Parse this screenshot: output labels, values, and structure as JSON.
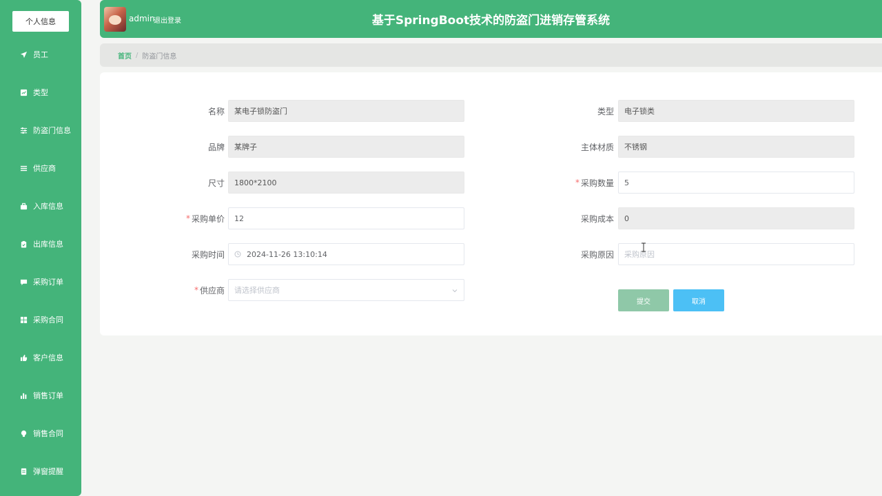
{
  "sidebar": {
    "profile_label": "个人信息",
    "items": [
      {
        "label": "员工",
        "icon": "paper-plane-icon"
      },
      {
        "label": "类型",
        "icon": "chart-icon"
      },
      {
        "label": "防盗门信息",
        "icon": "sliders-icon"
      },
      {
        "label": "供应商",
        "icon": "list-icon"
      },
      {
        "label": "入库信息",
        "icon": "briefcase-icon"
      },
      {
        "label": "出库信息",
        "icon": "clipboard-icon"
      },
      {
        "label": "采购订单",
        "icon": "comment-icon"
      },
      {
        "label": "采购合同",
        "icon": "grid-icon"
      },
      {
        "label": "客户信息",
        "icon": "thumbs-up-icon"
      },
      {
        "label": "销售订单",
        "icon": "bar-chart-icon"
      },
      {
        "label": "销售合同",
        "icon": "bulb-icon"
      },
      {
        "label": "弹窗提醒",
        "icon": "document-icon"
      }
    ]
  },
  "header": {
    "username": "admin",
    "logout": "退出登录",
    "title": "基于SpringBoot技术的防盗门进销存管系统"
  },
  "breadcrumb": {
    "home": "首页",
    "separator": "/",
    "current": "防盗门信息"
  },
  "form": {
    "name": {
      "label": "名称",
      "value": "某电子锁防盗门"
    },
    "type": {
      "label": "类型",
      "value": "电子锁类"
    },
    "brand": {
      "label": "品牌",
      "value": "某牌子"
    },
    "material": {
      "label": "主体材质",
      "value": "不锈钢"
    },
    "size": {
      "label": "尺寸",
      "value": "1800*2100"
    },
    "quantity": {
      "label": "采购数量",
      "value": "5",
      "required_mark": "*"
    },
    "unit_price": {
      "label": "采购单价",
      "value": "12",
      "required_mark": "*"
    },
    "cost": {
      "label": "采购成本",
      "value": "0"
    },
    "time": {
      "label": "采购时间",
      "value": "2024-11-26 13:10:14"
    },
    "reason": {
      "label": "采购原因",
      "placeholder": "采购原因"
    },
    "supplier": {
      "label": "供应商",
      "placeholder": "请选择供应商",
      "required_mark": "*"
    },
    "submit_label": "提交",
    "cancel_label": "取消"
  },
  "colors": {
    "brand_green": "#44b47a",
    "submit_bg": "#8fc8a8",
    "cancel_bg": "#4cc0f5",
    "required": "#f56c6c"
  }
}
